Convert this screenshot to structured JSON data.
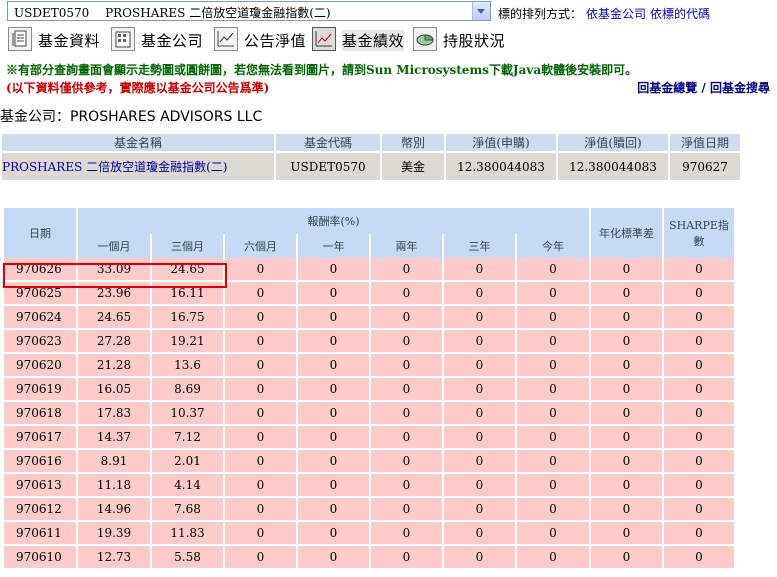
{
  "topbar": {
    "selected_fund": "USDET0570 　PROSHARES 二倍放空道瓊金融指數(二)",
    "sort_label": "標的排列方式：",
    "sort_by_company": "依基金公司",
    "sort_by_code": "依標的代碼"
  },
  "tabs": [
    {
      "label": "基金資料",
      "icon": "document-icon"
    },
    {
      "label": "基金公司",
      "icon": "building-icon"
    },
    {
      "label": "公告淨值",
      "icon": "line-chart-icon"
    },
    {
      "label": "基金績效",
      "icon": "performance-chart-icon"
    },
    {
      "label": "持股狀況",
      "icon": "pie-chart-icon"
    }
  ],
  "notice": {
    "prefix": "※有部分查詢畫面會顯示走勢圖或圓餅圖，若您無法看到圖片，請到",
    "sun": "Sun Microsystems",
    "suffix": "下載Java軟體後安裝即可。",
    "disclaimer": "(以下資料僅供參考，實際應以基金公司公告爲準)",
    "link_overview": "回基金總覽",
    "separator": "/",
    "link_search": "回基金搜尋"
  },
  "company_line": "基金公司：PROSHARES ADVISORS LLC",
  "info": {
    "headers": [
      "基金名稱",
      "基金代碼",
      "幣別",
      "淨值(申購)",
      "淨值(贖回)",
      "淨值日期"
    ],
    "row": [
      "PROSHARES 二倍放空道瓊金融指數(二)",
      "USDET0570",
      "美金",
      "12.380044083",
      "12.380044083",
      "970627"
    ]
  },
  "perf": {
    "date_header": "日期",
    "return_header": "報酬率(%)",
    "periods": [
      "一個月",
      "三個月",
      "六個月",
      "一年",
      "兩年",
      "三年",
      "今年"
    ],
    "std_header": "年化標準差",
    "sharpe_header": "SHARPE指數",
    "rows": [
      [
        "970626",
        "33.09",
        "24.65",
        "0",
        "0",
        "0",
        "0",
        "0",
        "0",
        "0"
      ],
      [
        "970625",
        "23.96",
        "16.11",
        "0",
        "0",
        "0",
        "0",
        "0",
        "0",
        "0"
      ],
      [
        "970624",
        "24.65",
        "16.75",
        "0",
        "0",
        "0",
        "0",
        "0",
        "0",
        "0"
      ],
      [
        "970623",
        "27.28",
        "19.21",
        "0",
        "0",
        "0",
        "0",
        "0",
        "0",
        "0"
      ],
      [
        "970620",
        "21.28",
        "13.6",
        "0",
        "0",
        "0",
        "0",
        "0",
        "0",
        "0"
      ],
      [
        "970619",
        "16.05",
        "8.69",
        "0",
        "0",
        "0",
        "0",
        "0",
        "0",
        "0"
      ],
      [
        "970618",
        "17.83",
        "10.37",
        "0",
        "0",
        "0",
        "0",
        "0",
        "0",
        "0"
      ],
      [
        "970617",
        "14.37",
        "7.12",
        "0",
        "0",
        "0",
        "0",
        "0",
        "0",
        "0"
      ],
      [
        "970616",
        "8.91",
        "2.01",
        "0",
        "0",
        "0",
        "0",
        "0",
        "0",
        "0"
      ],
      [
        "970613",
        "11.18",
        "4.14",
        "0",
        "0",
        "0",
        "0",
        "0",
        "0",
        "0"
      ],
      [
        "970612",
        "14.96",
        "7.68",
        "0",
        "0",
        "0",
        "0",
        "0",
        "0",
        "0"
      ],
      [
        "970611",
        "19.39",
        "11.83",
        "0",
        "0",
        "0",
        "0",
        "0",
        "0",
        "0"
      ],
      [
        "970610",
        "12.73",
        "5.58",
        "0",
        "0",
        "0",
        "0",
        "0",
        "0",
        "0"
      ]
    ]
  }
}
